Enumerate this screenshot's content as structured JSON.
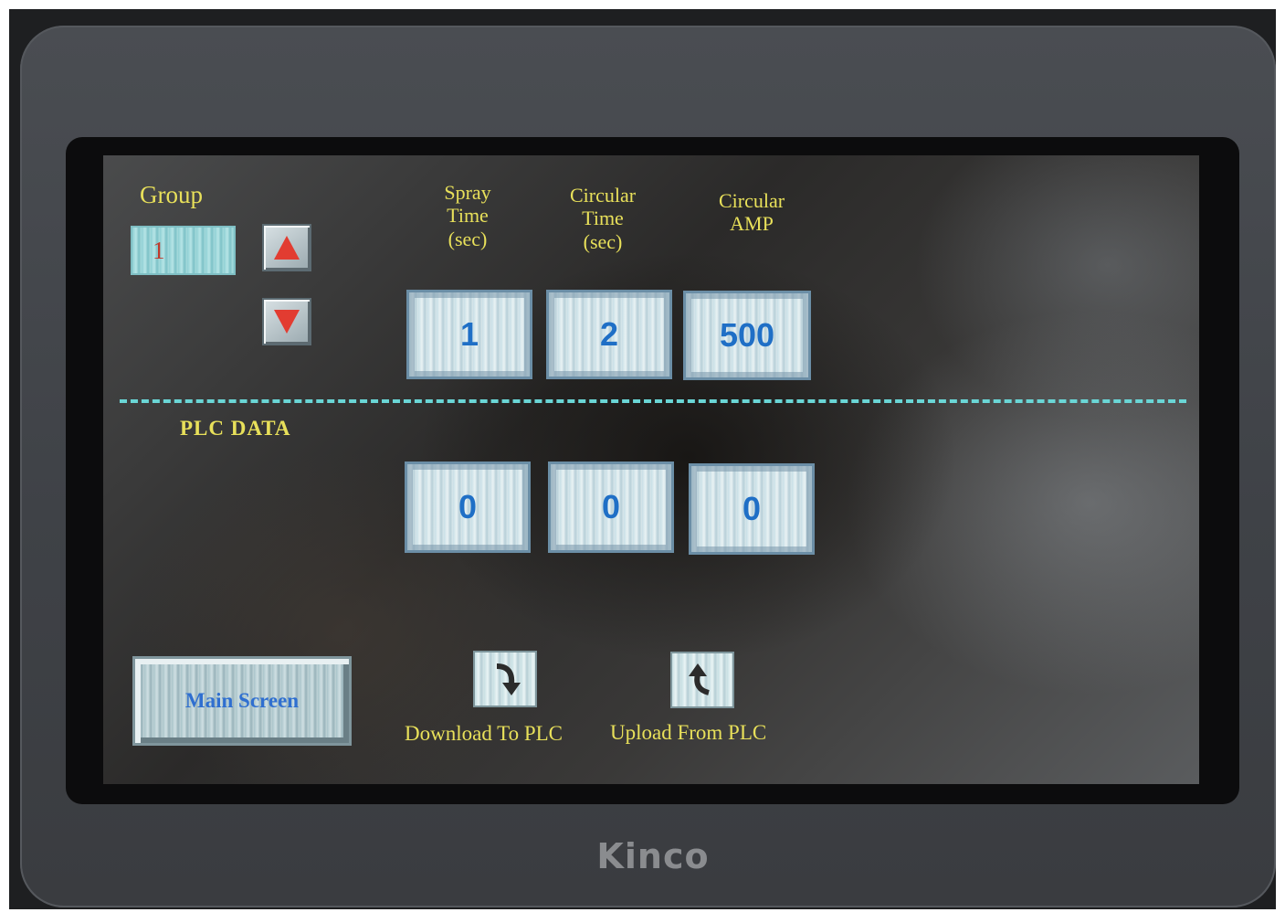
{
  "brand": "Kinco",
  "group": {
    "label": "Group",
    "value": "1"
  },
  "columns": [
    {
      "label": "Spray\nTime\n(sec)",
      "setpoint": "1",
      "plc": "0"
    },
    {
      "label": "Circular\nTime\n(sec)",
      "setpoint": "2",
      "plc": "0"
    },
    {
      "label": "Circular\nAMP",
      "setpoint": "500",
      "plc": "0"
    }
  ],
  "plc_section": {
    "label": "PLC  DATA"
  },
  "buttons": {
    "main_screen": "Main Screen",
    "download": "Download To PLC",
    "upload": "Upload From PLC"
  },
  "icons": {
    "group_up": "arrow-up-icon",
    "group_down": "arrow-down-icon",
    "download": "curved-arrow-down-icon",
    "upload": "curved-arrow-up-icon"
  },
  "colors": {
    "label_yellow": "#e8e05a",
    "value_blue": "#1f6fc6",
    "group_value_red": "#c0392b",
    "arrow_red": "#e23c31",
    "divider_cyan": "#6ad6d6"
  }
}
